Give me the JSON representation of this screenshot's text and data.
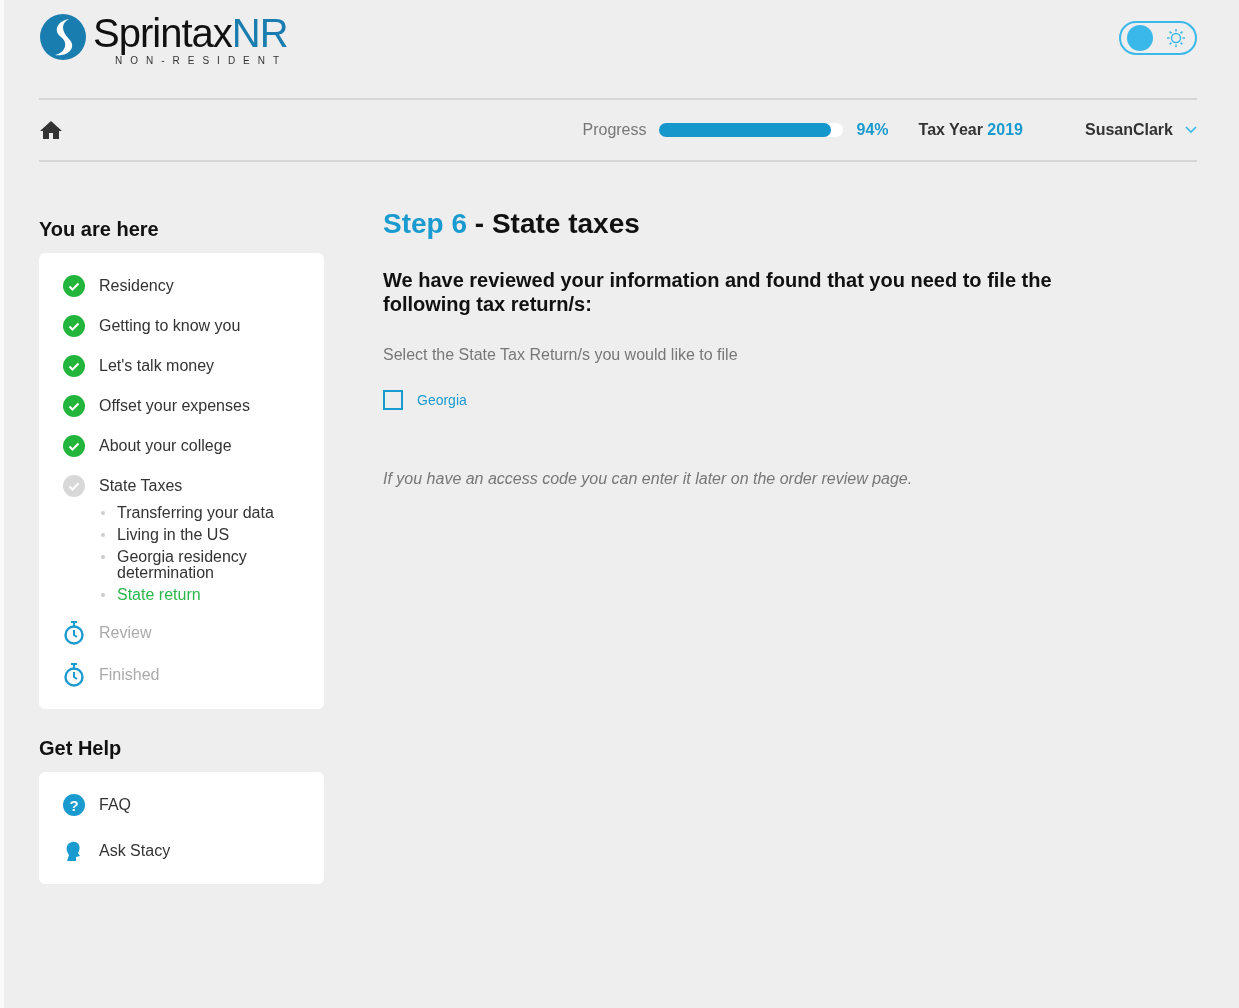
{
  "logo": {
    "name": "Sprintax",
    "suffix": "NR",
    "tagline": "NON-RESIDENT"
  },
  "theme_toggle": {
    "on": false
  },
  "nav": {
    "progress_label": "Progress",
    "progress": {
      "level": 0.94
    },
    "progress_reading": "94%",
    "tax_year_label": "Tax Year",
    "tax_year": "2019",
    "user": "SusanClark"
  },
  "sidebar": {
    "title": "You are here",
    "steps": [
      {
        "label": "Residency",
        "kind": "done"
      },
      {
        "label": "Getting to know you",
        "kind": "done"
      },
      {
        "label": "Let's talk money",
        "kind": "done"
      },
      {
        "label": "Offset your expenses",
        "kind": "done"
      },
      {
        "label": "About your college",
        "kind": "done"
      },
      {
        "label": "State Taxes",
        "kind": "current",
        "children": [
          {
            "label": "Transferring your data",
            "selected": false
          },
          {
            "label": "Living in the US",
            "selected": false
          },
          {
            "label": "Georgia residency determination",
            "selected": false
          },
          {
            "label": "State return",
            "selected": true
          }
        ]
      },
      {
        "label": "Review",
        "kind": "pending"
      },
      {
        "label": "Finished",
        "kind": "pending"
      }
    ],
    "help_title": "Get Help",
    "help": [
      {
        "label": "FAQ",
        "kind": "faq",
        "icon": "?"
      },
      {
        "label": "Ask Stacy",
        "kind": "chat"
      }
    ]
  },
  "main": {
    "step": "Step 6",
    "title": "- State taxes",
    "intro": "We have reviewed your information and found that you need to file the following tax return/s:",
    "prompt": "Select the State Tax Return/s you would like to file",
    "options": [
      {
        "label": "Georgia",
        "checked": false
      }
    ],
    "note": "If you have an access code you can enter it later on the order review page."
  }
}
